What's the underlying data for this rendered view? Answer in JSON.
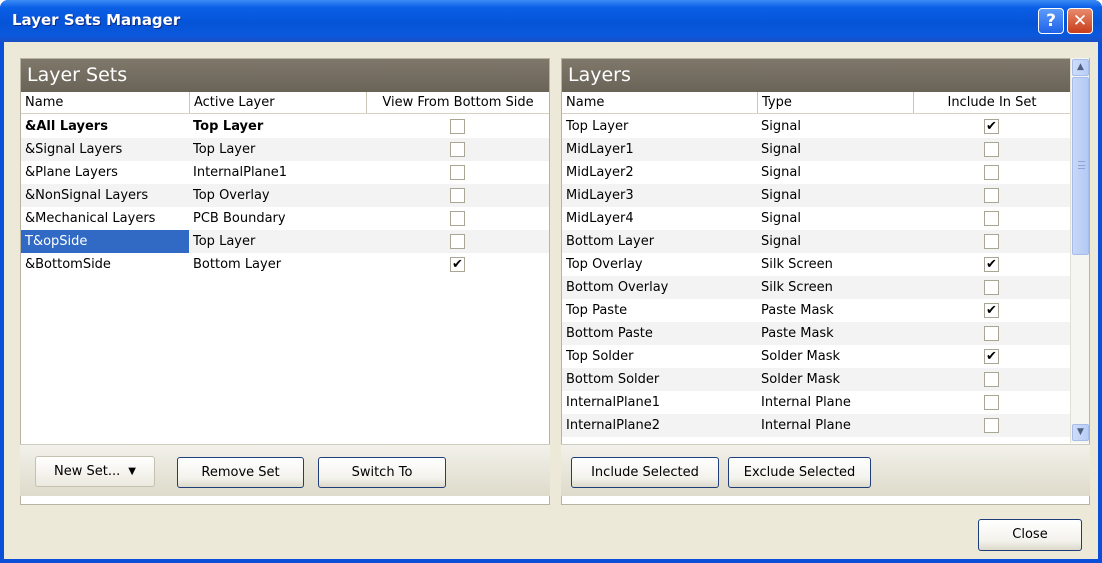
{
  "window": {
    "title": "Layer Sets Manager",
    "help_glyph": "?",
    "close_glyph": "✕"
  },
  "layer_sets": {
    "header": "Layer Sets",
    "columns": {
      "name": "Name",
      "active_layer": "Active Layer",
      "view_from_bottom": "View From Bottom Side"
    },
    "rows": [
      {
        "name": "&All Layers",
        "active_layer": "Top Layer",
        "view_from_bottom": false,
        "bold": true,
        "selected": false
      },
      {
        "name": "&Signal Layers",
        "active_layer": "Top Layer",
        "view_from_bottom": false,
        "bold": false,
        "selected": false
      },
      {
        "name": "&Plane Layers",
        "active_layer": "InternalPlane1",
        "view_from_bottom": false,
        "bold": false,
        "selected": false
      },
      {
        "name": "&NonSignal Layers",
        "active_layer": "Top Overlay",
        "view_from_bottom": false,
        "bold": false,
        "selected": false
      },
      {
        "name": "&Mechanical Layers",
        "active_layer": "PCB Boundary",
        "view_from_bottom": false,
        "bold": false,
        "selected": false
      },
      {
        "name": "T&opSide",
        "active_layer": "Top Layer",
        "view_from_bottom": false,
        "bold": false,
        "selected": true
      },
      {
        "name": "&BottomSide",
        "active_layer": "Bottom Layer",
        "view_from_bottom": true,
        "bold": false,
        "selected": false
      }
    ],
    "buttons": {
      "new_set": "New Set...",
      "remove_set": "Remove Set",
      "switch_to": "Switch To"
    }
  },
  "layers": {
    "header": "Layers",
    "columns": {
      "name": "Name",
      "type": "Type",
      "include": "Include In Set"
    },
    "rows": [
      {
        "name": "Top Layer",
        "type": "Signal",
        "include": true
      },
      {
        "name": "MidLayer1",
        "type": "Signal",
        "include": false
      },
      {
        "name": "MidLayer2",
        "type": "Signal",
        "include": false
      },
      {
        "name": "MidLayer3",
        "type": "Signal",
        "include": false
      },
      {
        "name": "MidLayer4",
        "type": "Signal",
        "include": false
      },
      {
        "name": "Bottom Layer",
        "type": "Signal",
        "include": false
      },
      {
        "name": "Top Overlay",
        "type": "Silk Screen",
        "include": true
      },
      {
        "name": "Bottom Overlay",
        "type": "Silk Screen",
        "include": false
      },
      {
        "name": "Top Paste",
        "type": "Paste Mask",
        "include": true
      },
      {
        "name": "Bottom Paste",
        "type": "Paste Mask",
        "include": false
      },
      {
        "name": "Top Solder",
        "type": "Solder Mask",
        "include": true
      },
      {
        "name": "Bottom Solder",
        "type": "Solder Mask",
        "include": false
      },
      {
        "name": "InternalPlane1",
        "type": "Internal Plane",
        "include": false
      },
      {
        "name": "InternalPlane2",
        "type": "Internal Plane",
        "include": false
      }
    ],
    "buttons": {
      "include_selected": "Include Selected",
      "exclude_selected": "Exclude Selected"
    }
  },
  "footer": {
    "close": "Close"
  },
  "colors": {
    "title_bar": "#0554d8",
    "panel_header": "#736c60",
    "selection": "#316ac5",
    "dialog_face": "#ece9d8"
  }
}
